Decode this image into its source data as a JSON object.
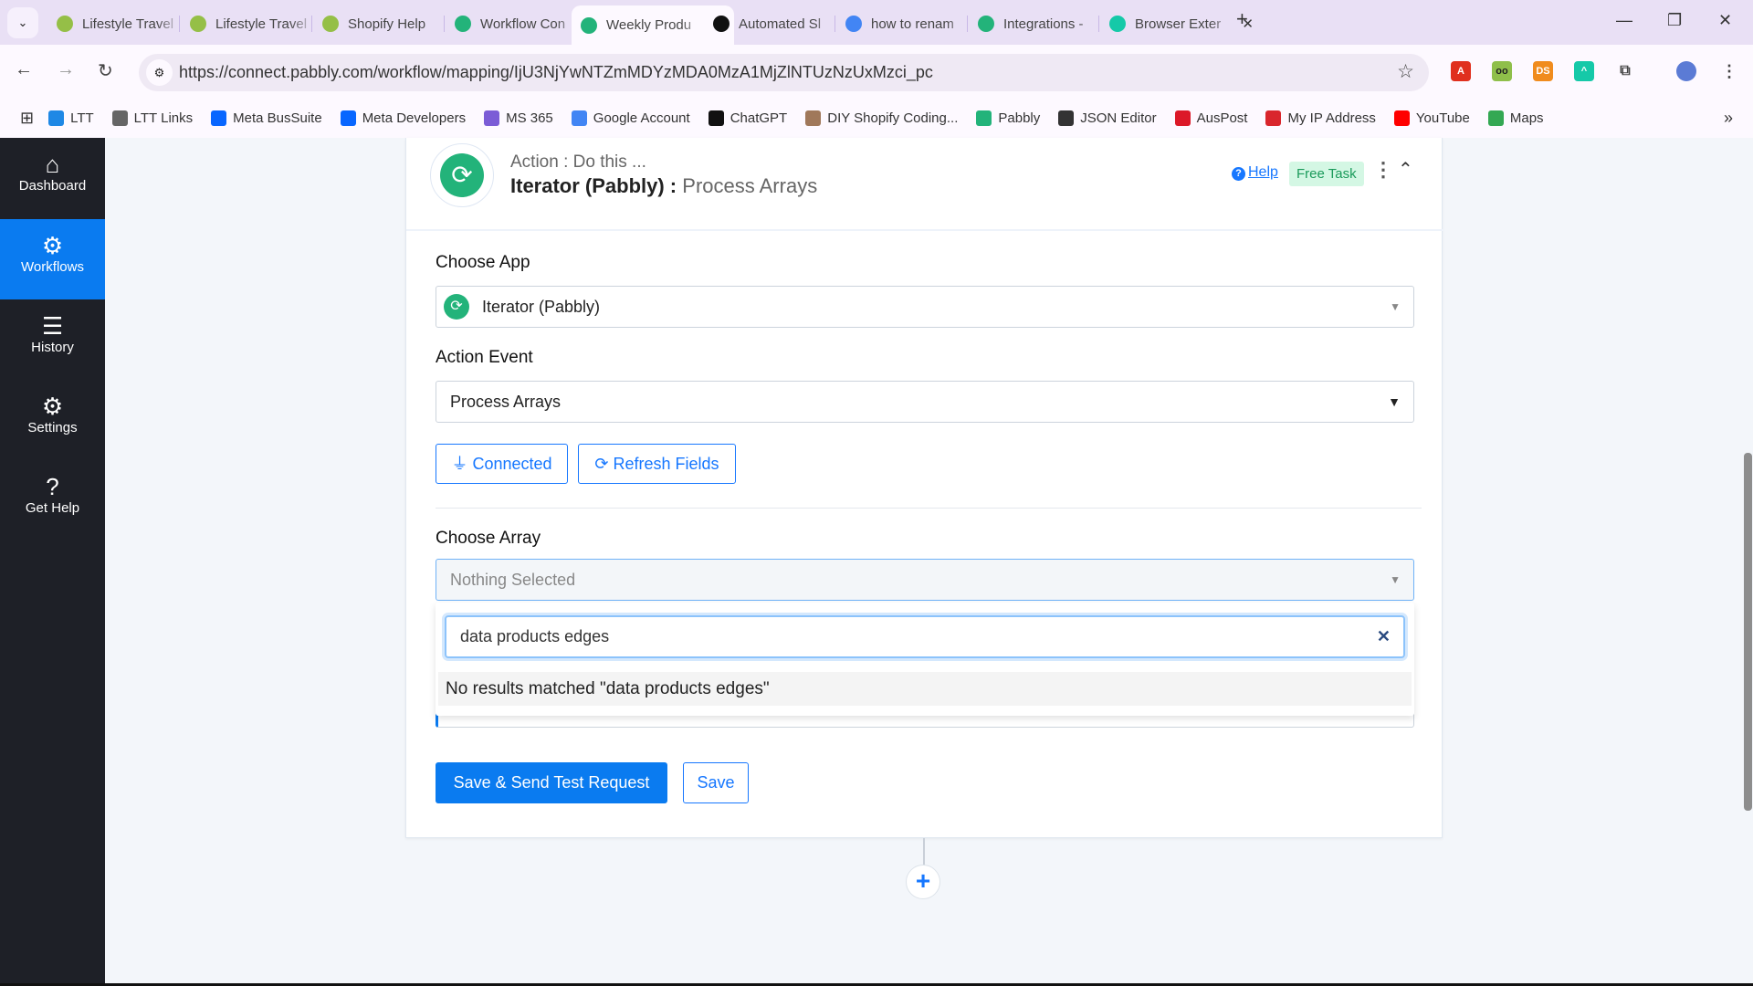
{
  "browser": {
    "tabs": [
      {
        "title": "Lifestyle Travel",
        "icon": "shopify-icon",
        "color": "#95bf47"
      },
      {
        "title": "Lifestyle Travel",
        "icon": "shopify-icon",
        "color": "#95bf47"
      },
      {
        "title": "Shopify Help",
        "icon": "shopify-icon",
        "color": "#95bf47"
      },
      {
        "title": "Workflow Con",
        "icon": "pabbly-icon",
        "color": "#23b37a"
      },
      {
        "title": "Weekly Produ",
        "icon": "pabbly-icon",
        "color": "#23b37a",
        "active": true
      },
      {
        "title": "Automated Sl",
        "icon": "chatgpt-icon",
        "color": "#111111"
      },
      {
        "title": "how to renam",
        "icon": "google-icon",
        "color": "#4285f4"
      },
      {
        "title": "Integrations -",
        "icon": "pabbly-icon",
        "color": "#23b37a"
      },
      {
        "title": "Browser Exter",
        "icon": "extension-icon",
        "color": "#15c9a8"
      }
    ],
    "url": "https://connect.pabbly.com/workflow/mapping/IjU3NjYwNTZmMDYzMDA0MzA1MjZlNTUzNzUxMzci_pc",
    "bookmarks": [
      {
        "label": "LTT",
        "color": "#1e88e5"
      },
      {
        "label": "LTT Links",
        "color": "#666666"
      },
      {
        "label": "Meta BusSuite",
        "color": "#0866ff"
      },
      {
        "label": "Meta Developers",
        "color": "#0866ff"
      },
      {
        "label": "MS 365",
        "color": "#7b5cd6"
      },
      {
        "label": "Google Account",
        "color": "#4285f4"
      },
      {
        "label": "ChatGPT",
        "color": "#111111"
      },
      {
        "label": "DIY Shopify Coding...",
        "color": "#a0785a"
      },
      {
        "label": "Pabbly",
        "color": "#23b37a"
      },
      {
        "label": "JSON Editor",
        "color": "#333333"
      },
      {
        "label": "AusPost",
        "color": "#dc1928"
      },
      {
        "label": "My IP Address",
        "color": "#d9262c"
      },
      {
        "label": "YouTube",
        "color": "#ff0000"
      },
      {
        "label": "Maps",
        "color": "#34a853"
      }
    ]
  },
  "sidebar": {
    "items": [
      {
        "label": "Dashboard",
        "icon": "home-icon"
      },
      {
        "label": "Workflows",
        "icon": "workflow-icon",
        "active": true
      },
      {
        "label": "History",
        "icon": "list-icon"
      },
      {
        "label": "Settings",
        "icon": "gear-icon"
      },
      {
        "label": "Get Help",
        "icon": "help-icon"
      }
    ]
  },
  "card": {
    "subtitle": "Action : Do this ...",
    "app_name": "Iterator (Pabbly) :",
    "event_name": "Process Arrays",
    "help": "Help",
    "badge": "Free Task",
    "choose_app_label": "Choose App",
    "choose_app_value": "Iterator (Pabbly)",
    "action_event_label": "Action Event",
    "action_event_value": "Process Arrays",
    "connected": "Connected",
    "refresh": "Refresh Fields",
    "choose_array_label": "Choose Array",
    "choose_array_placeholder": "Nothing Selected",
    "search_value": "data products edges",
    "no_results": "No results matched \"data products edges\"",
    "save_test": "Save & Send Test Request",
    "save": "Save"
  },
  "colors": {
    "accent": "#0a7bf0",
    "sidebar": "#1e2027",
    "pabbly": "#23b37a"
  }
}
